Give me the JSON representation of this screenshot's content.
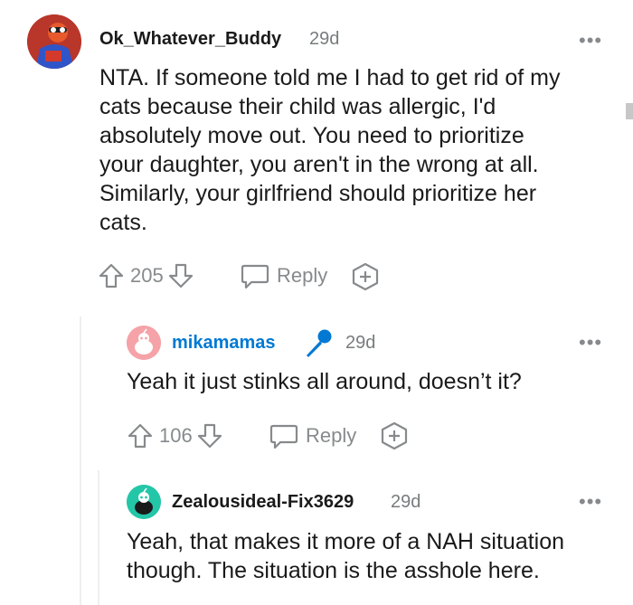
{
  "comments": [
    {
      "username": "Ok_Whatever_Buddy",
      "time": "29d",
      "body_lines": [
        "NTA. If someone told me I had to get rid of my",
        "cats because their child was allergic, I'd",
        "absolutely move out. You need to prioritize",
        "your daughter, you aren't in the wrong at all.",
        "Similarly, your girlfriend should prioritize her",
        "cats."
      ],
      "votes": "205",
      "reply_label": "Reply",
      "more": "•••"
    },
    {
      "username": "mikamamas",
      "username_color": "#0079d3",
      "time": "29d",
      "body_lines": [
        "Yeah it just stinks all around, doesn’t it?"
      ],
      "votes": "106",
      "reply_label": "Reply",
      "more": "•••",
      "badge_icon": "microphone-icon"
    },
    {
      "username": "Zealousideal-Fix3629",
      "time": "29d",
      "body_lines": [
        "Yeah, that makes it more of a NAH situation",
        "though. The situation is the asshole here."
      ],
      "more": "•••"
    }
  ],
  "colors": {
    "meta": "#787c7e",
    "icon": "#878a8c",
    "op_link": "#0079d3",
    "avatar_pink": "#f5a3a8",
    "avatar_teal": "#24c6a8"
  }
}
